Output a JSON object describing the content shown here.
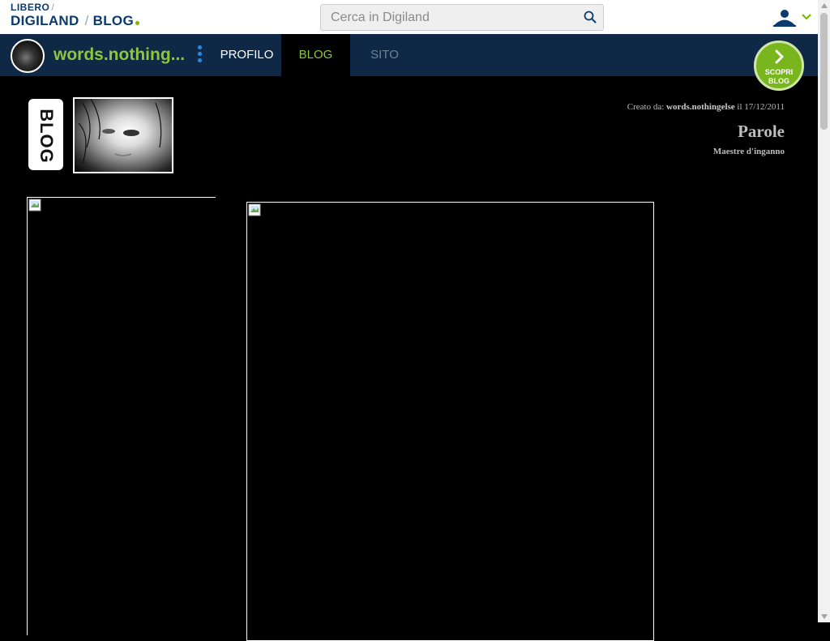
{
  "header": {
    "logo_libero": "LIBERO",
    "logo_slash1": "/",
    "logo_digiland": "DIGILAND",
    "logo_slash2": "/",
    "logo_blog": "BLOG",
    "search_placeholder": "Cerca in Digiland",
    "search_icon": "search-icon",
    "user_icon": "user-icon"
  },
  "navbar": {
    "blog_name": "words.nothing...",
    "tabs": [
      {
        "label": "PROFILO"
      },
      {
        "label": "BLOG"
      },
      {
        "label": "SITO"
      }
    ],
    "active_tab": "BLOG",
    "scopri_line1": "SCOPRI",
    "scopri_line2": "BLOG"
  },
  "content": {
    "badge_text": "BLOG",
    "created_prefix": "Creato da:",
    "author": "words.nothingelse",
    "created_date": "il 17/12/2011",
    "title": "Parole",
    "subtitle": "Maestre d'inganno"
  },
  "colors": {
    "brand_blue": "#0f2846",
    "accent_green": "#8dc63f",
    "background": "#000000"
  }
}
